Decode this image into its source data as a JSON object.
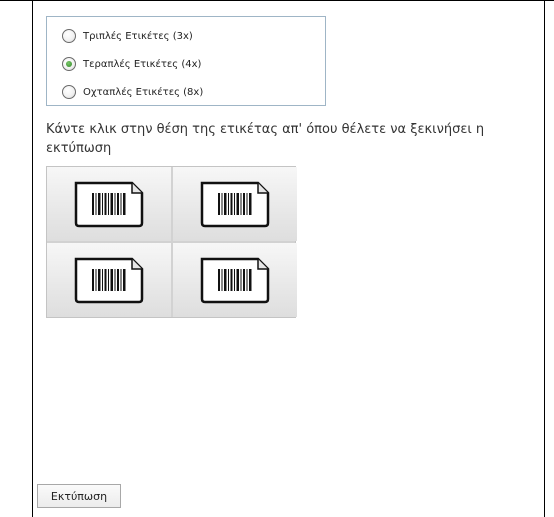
{
  "options": [
    {
      "label": "Τριπλές Ετικέτες (3x)",
      "checked": false
    },
    {
      "label": "Τεραπλές Ετικέτες (4x)",
      "checked": true
    },
    {
      "label": "Οχταπλές Ετικέτες (8x)",
      "checked": false
    }
  ],
  "instruction": "Κάντε κλικ στην θέση της ετικέτας απ' όπου θέλετε να ξεκινήσει η εκτύπωση",
  "label_positions": [
    {
      "icon": "barcode-label-icon"
    },
    {
      "icon": "barcode-label-icon"
    },
    {
      "icon": "barcode-label-icon"
    },
    {
      "icon": "barcode-label-icon"
    }
  ],
  "print_button": {
    "label": "Εκτύπωση"
  },
  "colors": {
    "selected_radio": "#2f8a24",
    "group_border": "#9fb5c6"
  }
}
